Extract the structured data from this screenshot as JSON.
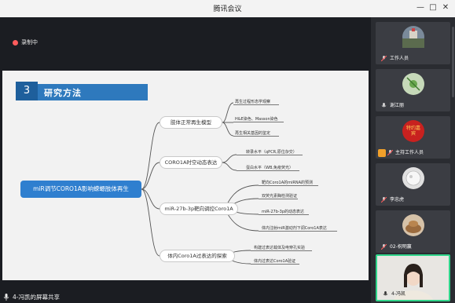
{
  "app": {
    "title": "腾讯会议"
  },
  "window": {
    "min": "—",
    "max": "□",
    "close": "✕"
  },
  "recording": {
    "label": "录制中"
  },
  "share": {
    "label": "4-冯凯的屏幕共享"
  },
  "slide": {
    "section_number": "3",
    "section_title": "研究方法",
    "root": "miR调节CORO1A影响蝾螈肢体再生",
    "branches": [
      {
        "label": "肢体正常再生模型",
        "leaves": [
          "再生过程形态学观察",
          "H&E染色、Masson染色",
          "再生相关基因的鉴定"
        ]
      },
      {
        "label": "CORO1A时空动态表达",
        "leaves": [
          "转录水平（qPCR,原位杂交）",
          "蛋白水平（WB,免疫荧光）"
        ]
      },
      {
        "label": "miR-27b-3p靶向调控Coro1A",
        "leaves": [
          "靶向Coro1A的miRNA的预测",
          "双荧光素酶检测验证",
          "miR-27b-3p的动态表达",
          "体内注射miR激动剂下调Coro1A表达"
        ]
      },
      {
        "label": "体内Coro1A过表达的探索",
        "leaves": [
          "构建过表达载体及电穿孔实验",
          "体内过表达Coro1A验证"
        ]
      }
    ]
  },
  "participants": [
    {
      "name": "工作人员",
      "role": ""
    },
    {
      "name": "谢江丽",
      "role": ""
    },
    {
      "name": "主持工作人员",
      "role": "host",
      "avatar_text": "特约嘉宾"
    },
    {
      "name": "李忠虎",
      "role": ""
    },
    {
      "name": "02-祝明赢",
      "role": ""
    },
    {
      "name": "4-冯凯",
      "role": ""
    }
  ],
  "colors": {
    "accent": "#2f7fcf",
    "active_border": "#2fd58a",
    "record": "#ff5c5c"
  }
}
